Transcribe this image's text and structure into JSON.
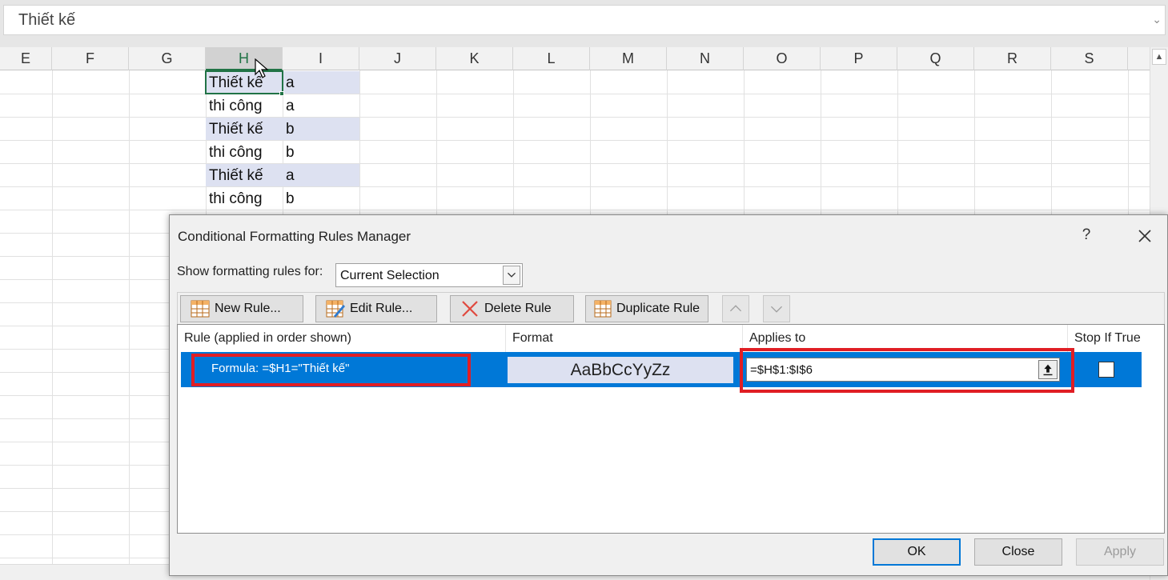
{
  "formula_bar": {
    "value": "Thiết kế"
  },
  "sheet": {
    "columns": [
      "E",
      "F",
      "G",
      "H",
      "I",
      "J",
      "K",
      "L",
      "M",
      "N",
      "O",
      "P",
      "Q",
      "R",
      "S"
    ],
    "active_column": "H",
    "rows": [
      {
        "h": "Thiết kế",
        "i": "a",
        "highlighted": true
      },
      {
        "h": "thi công",
        "i": "a",
        "highlighted": false
      },
      {
        "h": "Thiết kế",
        "i": "b",
        "highlighted": true
      },
      {
        "h": "thi công",
        "i": "b",
        "highlighted": false
      },
      {
        "h": "Thiết kế",
        "i": "a",
        "highlighted": true
      },
      {
        "h": "thi công",
        "i": "b",
        "highlighted": false
      }
    ]
  },
  "dialog": {
    "title": "Conditional Formatting Rules Manager",
    "help": "?",
    "show_rules_for": {
      "label": "Show formatting rules for:",
      "value": "Current Selection"
    },
    "toolbar": {
      "new_rule": "New Rule...",
      "edit_rule": "Edit Rule...",
      "delete_rule": "Delete Rule",
      "duplicate_rule": "Duplicate Rule"
    },
    "table": {
      "headers": {
        "rule": "Rule (applied in order shown)",
        "format": "Format",
        "applies_to": "Applies to",
        "stop_if_true": "Stop If True"
      },
      "rules": [
        {
          "rule": "Formula: =$H1=\"Thiết kế\"",
          "format_preview": "AaBbCcYyZz",
          "applies_to": "=$H$1:$I$6",
          "stop_if_true": false
        }
      ]
    },
    "buttons": {
      "ok": "OK",
      "close": "Close",
      "apply": "Apply"
    }
  },
  "colors": {
    "selection_blue": "#0078d7",
    "highlight_fill": "#dde1f1",
    "annotation_red": "#e01e24",
    "excel_green": "#217346"
  }
}
